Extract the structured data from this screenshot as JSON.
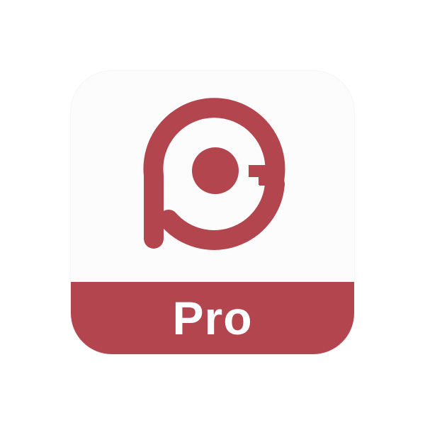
{
  "app_icon": {
    "name": "PC Pro",
    "label": "Pro",
    "logo_icon": "pc-monogram-icon"
  },
  "colors": {
    "brand": "#b3454f",
    "background": "#fcfcfc",
    "label_text": "#ffffff"
  }
}
